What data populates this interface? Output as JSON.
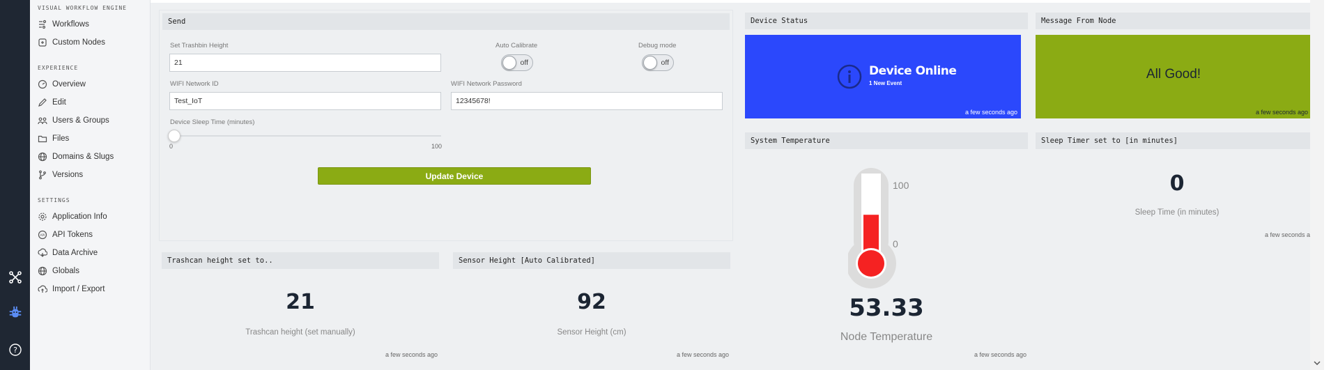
{
  "sidebar": {
    "sections": [
      {
        "title": "VISUAL WORKFLOW ENGINE",
        "items": [
          {
            "label": "Workflows",
            "icon": "workflow-icon"
          },
          {
            "label": "Custom Nodes",
            "icon": "custom-nodes-icon"
          }
        ]
      },
      {
        "title": "EXPERIENCE",
        "items": [
          {
            "label": "Overview",
            "icon": "overview-icon"
          },
          {
            "label": "Edit",
            "icon": "edit-icon"
          },
          {
            "label": "Users & Groups",
            "icon": "users-groups-icon"
          },
          {
            "label": "Files",
            "icon": "folder-icon"
          },
          {
            "label": "Domains & Slugs",
            "icon": "globe-icon"
          },
          {
            "label": "Versions",
            "icon": "branch-icon"
          }
        ]
      },
      {
        "title": "SETTINGS",
        "items": [
          {
            "label": "Application Info",
            "icon": "gear-icon"
          },
          {
            "label": "API Tokens",
            "icon": "api-token-icon"
          },
          {
            "label": "Data Archive",
            "icon": "archive-icon"
          },
          {
            "label": "Globals",
            "icon": "globe-icon"
          },
          {
            "label": "Import / Export",
            "icon": "import-export-icon"
          }
        ]
      }
    ]
  },
  "send": {
    "title": "Send",
    "trashbin_label": "Set Trashbin Height",
    "trashbin_value": "21",
    "autocal_label": "Auto Calibrate",
    "autocal_state": "off",
    "debug_label": "Debug mode",
    "debug_state": "off",
    "wifi_id_label": "WIFI Network ID",
    "wifi_id_value": "Test_IoT",
    "wifi_pw_label": "WIFI Network Password",
    "wifi_pw_value": "12345678!",
    "sleep_label": "Device Sleep Time (minutes)",
    "slider_min": "0",
    "slider_max": "100",
    "slider_value": 0,
    "button": "Update Device"
  },
  "status": {
    "title": "Device Status",
    "headline": "Device Online",
    "sub": "1 New Event",
    "time": "a few seconds ago",
    "color": "#2b48fc"
  },
  "message": {
    "title": "Message From Node",
    "text": "All Good!",
    "time": "a few seconds ago",
    "color": "#8bab14"
  },
  "temperature": {
    "title": "System Temperature",
    "max_label": "100",
    "min_label": "0",
    "value": "53.33",
    "caption": "Node Temperature",
    "time": "a few seconds ago",
    "fill_fraction": 0.53
  },
  "sleep_timer": {
    "title": "Sleep Timer set to [in minutes]",
    "value": "0",
    "caption": "Sleep Time (in minutes)",
    "time": "a few seconds ago"
  },
  "trash_height": {
    "title": "Trashcan height set to..",
    "value": "21",
    "caption": "Trashcan height (set manually)",
    "time": "a few seconds ago"
  },
  "sensor_height": {
    "title": "Sensor Height [Auto Calibrated]",
    "value": "92",
    "caption": "Sensor Height (cm)",
    "time": "a few seconds ago"
  },
  "colors": {
    "accent_green": "#8bab14",
    "status_blue": "#2b48fc",
    "thermo_red": "#f52222"
  }
}
